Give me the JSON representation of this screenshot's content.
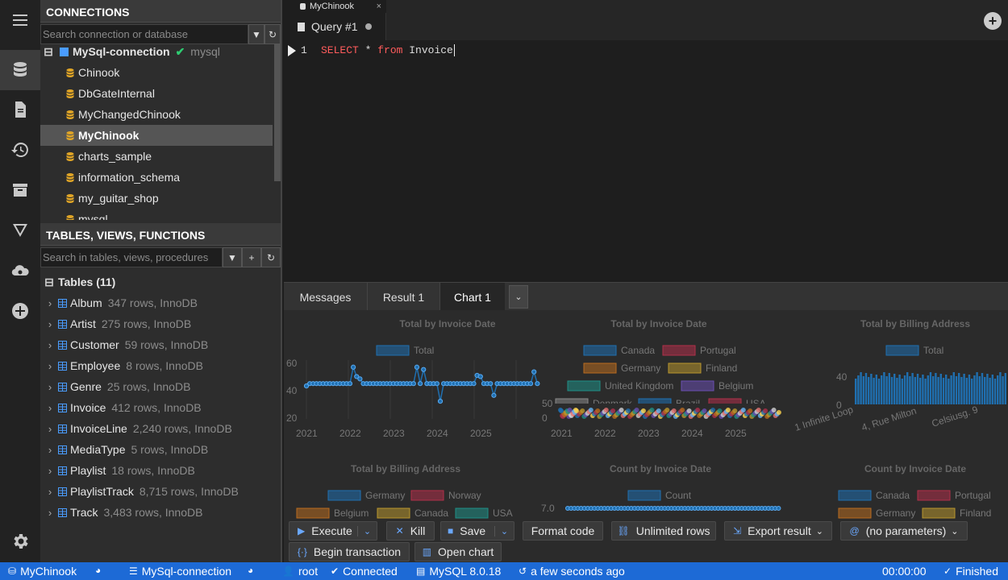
{
  "activity": {
    "items": [
      "menu-icon",
      "database-icon",
      "file-icon",
      "history-icon",
      "archive-icon",
      "filter-icon",
      "cloud-icon",
      "plus-circle-icon",
      "gear-icon"
    ]
  },
  "connections": {
    "header": "CONNECTIONS",
    "search_placeholder": "Search connection or database",
    "connection": {
      "name": "MySql-connection",
      "engine": "mysql"
    },
    "databases": [
      {
        "name": "Chinook",
        "selected": false
      },
      {
        "name": "DbGateInternal",
        "selected": false
      },
      {
        "name": "MyChangedChinook",
        "selected": false
      },
      {
        "name": "MyChinook",
        "selected": true
      },
      {
        "name": "charts_sample",
        "selected": false
      },
      {
        "name": "information_schema",
        "selected": false
      },
      {
        "name": "my_guitar_shop",
        "selected": false
      },
      {
        "name": "mysql",
        "selected": false
      }
    ]
  },
  "objects": {
    "header": "TABLES, VIEWS, FUNCTIONS",
    "search_placeholder": "Search in tables, views, procedures",
    "group_label": "Tables (11)",
    "tables": [
      {
        "name": "Album",
        "info": "347 rows, InnoDB"
      },
      {
        "name": "Artist",
        "info": "275 rows, InnoDB"
      },
      {
        "name": "Customer",
        "info": "59 rows, InnoDB"
      },
      {
        "name": "Employee",
        "info": "8 rows, InnoDB"
      },
      {
        "name": "Genre",
        "info": "25 rows, InnoDB"
      },
      {
        "name": "Invoice",
        "info": "412 rows, InnoDB"
      },
      {
        "name": "InvoiceLine",
        "info": "2,240 rows, InnoDB"
      },
      {
        "name": "MediaType",
        "info": "5 rows, InnoDB"
      },
      {
        "name": "Playlist",
        "info": "18 rows, InnoDB"
      },
      {
        "name": "PlaylistTrack",
        "info": "8,715 rows, InnoDB"
      },
      {
        "name": "Track",
        "info": "3,483 rows, InnoDB"
      }
    ]
  },
  "tabs": {
    "db_tab": "MyChinook",
    "close_glyph": "×",
    "query_tab": "Query #1",
    "add_glyph": "+"
  },
  "editor": {
    "line_number": "1",
    "kw_select": "SELECT",
    "star": " * ",
    "kw_from": "from",
    "table": " Invoice"
  },
  "result_tabs": [
    "Messages",
    "Result 1",
    "Chart 1"
  ],
  "charts": {
    "titles": [
      "Total by Invoice Date",
      "Total by Invoice Date",
      "Total by Billing Address",
      "Total by Billing Address",
      "Count by Invoice Date",
      "Count by Invoice Date"
    ],
    "c1": {
      "legend": "Total",
      "yticks": [
        "60",
        "40",
        "20"
      ],
      "xticks": [
        "2021",
        "2022",
        "2023",
        "2024",
        "2025"
      ]
    },
    "c2": {
      "legend": [
        "Canada",
        "Portugal",
        "Germany",
        "Finland",
        "United Kingdom",
        "Belgium",
        "Denmark",
        "Brazil",
        "USA"
      ],
      "yticks": [
        "50",
        "0"
      ],
      "xticks": [
        "2021",
        "2022",
        "2023",
        "2024",
        "2025"
      ]
    },
    "c3": {
      "legend": "Total",
      "yticks": [
        "40",
        "0"
      ],
      "xticks": [
        "1 Infinite Loop",
        "4, Rue Milton",
        "Celsiusg. 9"
      ]
    },
    "c4": {
      "legend": [
        "Germany",
        "Norway",
        "Belgium",
        "Canada",
        "USA"
      ]
    },
    "c5": {
      "legend": "Count",
      "yticks": [
        "7.0"
      ]
    },
    "c6": {
      "legend": [
        "Canada",
        "Portugal",
        "Germany",
        "Finland"
      ]
    },
    "colors": {
      "blue": "#1f6fb0",
      "red": "#b0304a",
      "orange": "#b86b1f",
      "yellow": "#b8962e",
      "teal": "#1f8f86",
      "purple": "#6a4fb0",
      "gray": "#888888"
    }
  },
  "toolbar": {
    "execute": "Execute",
    "kill": "Kill",
    "save": "Save",
    "format": "Format code",
    "unlimited": "Unlimited rows",
    "export": "Export result",
    "params": "(no parameters)",
    "begin_tx": "Begin transaction",
    "open_chart": "Open chart"
  },
  "status": {
    "db": "MyChinook",
    "connection": "MySql-connection",
    "user": "root",
    "state": "Connected",
    "server": "MySQL 8.0.18",
    "time_ago": "a few seconds ago",
    "duration": "00:00:00",
    "result": "Finished"
  }
}
